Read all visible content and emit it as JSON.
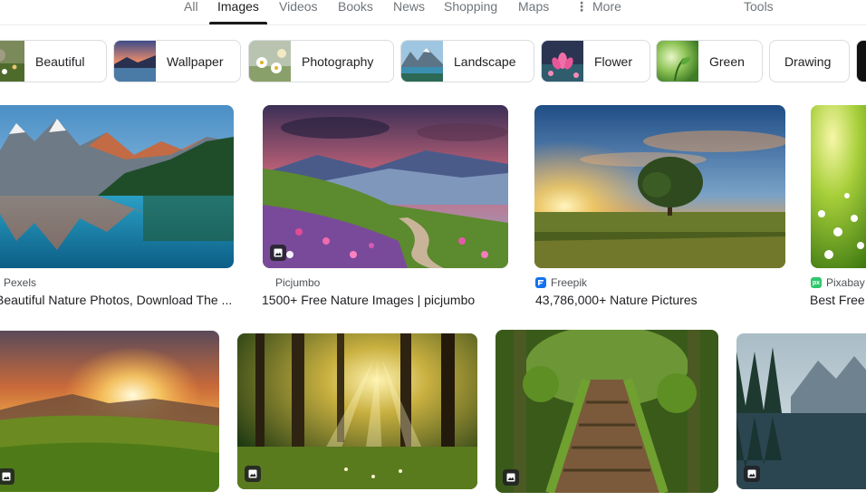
{
  "tabs": [
    {
      "label": "All",
      "active": false
    },
    {
      "label": "Images",
      "active": true
    },
    {
      "label": "Videos",
      "active": false
    },
    {
      "label": "Books",
      "active": false
    },
    {
      "label": "News",
      "active": false
    },
    {
      "label": "Shopping",
      "active": false
    },
    {
      "label": "Maps",
      "active": false
    },
    {
      "label": "More",
      "active": false
    }
  ],
  "tools_label": "Tools",
  "chips": [
    {
      "label": "Beautiful",
      "thumb_icon": "flower-field-thumbnail"
    },
    {
      "label": "Wallpaper",
      "thumb_icon": "sunset-lake-thumbnail"
    },
    {
      "label": "Photography",
      "thumb_icon": "daisies-thumbnail"
    },
    {
      "label": "Landscape",
      "thumb_icon": "mountain-lake-thumbnail"
    },
    {
      "label": "Flower",
      "thumb_icon": "pink-lotus-thumbnail"
    },
    {
      "label": "Green",
      "thumb_icon": "green-leaves-thumbnail"
    },
    {
      "label": "Drawing",
      "thumb_icon": ""
    }
  ],
  "results_row1": [
    {
      "source": "Pexels",
      "title": "Beautiful Nature Photos, Download The ...",
      "image": "mountain-lake-image",
      "has_badge": false
    },
    {
      "source": "Picjumbo",
      "title": "1500+ Free Nature Images | picjumbo",
      "image": "flower-valley-path-image",
      "has_badge": true
    },
    {
      "source": "Freepik",
      "title": "43,786,000+ Nature Pictures",
      "image": "lone-tree-sunset-image",
      "has_badge": false,
      "favicon_color": "#1273eb"
    },
    {
      "source": "Pixabay",
      "title": "Best Free",
      "image": "sunlit-daisy-meadow-image",
      "has_badge": false,
      "favicon_color": "#2ec66d",
      "favicon_text": "px"
    }
  ],
  "results_row2": [
    {
      "image": "sunset-meadow-hills-image",
      "has_badge": true
    },
    {
      "image": "forest-sunbeams-image",
      "has_badge": true
    },
    {
      "image": "mossy-wooden-bridge-image",
      "has_badge": true
    },
    {
      "image": "misty-mountain-lake-image",
      "has_badge": true
    }
  ],
  "colors": {
    "active_tab_underline": "#1a1a1a",
    "tab_text": "#70757a",
    "chip_border": "#dadce0",
    "freepik_blue": "#1273eb",
    "pixabay_green": "#2ec66d"
  }
}
